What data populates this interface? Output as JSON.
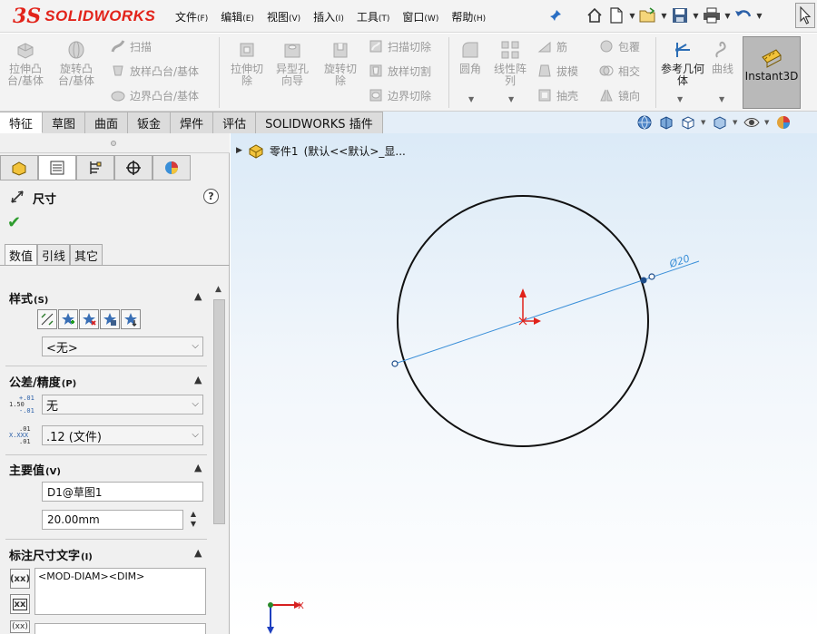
{
  "app": {
    "logo_prefix": "3S",
    "brand": "SOLIDWORKS"
  },
  "menu": [
    {
      "label": "文件",
      "key": "(F)"
    },
    {
      "label": "编辑",
      "key": "(E)"
    },
    {
      "label": "视图",
      "key": "(V)"
    },
    {
      "label": "插入",
      "key": "(I)"
    },
    {
      "label": "工具",
      "key": "(T)"
    },
    {
      "label": "窗口",
      "key": "(W)"
    },
    {
      "label": "帮助",
      "key": "(H)"
    }
  ],
  "ribbon": {
    "extrude_boss": "拉伸凸台/基体",
    "revolve_boss": "旋转凸台/基体",
    "sweep": "扫描",
    "loft_boss": "放样凸台/基体",
    "boundary_boss": "边界凸台/基体",
    "extrude_cut": "拉伸切除",
    "hole_wizard": "异型孔向导",
    "revolve_cut": "旋转切除",
    "swept_cut": "扫描切除",
    "lofted_cut": "放样切割",
    "boundary_cut": "边界切除",
    "fillet": "圆角",
    "linear_pattern": "线性阵列",
    "rib": "筋",
    "draft": "拔模",
    "shell": "抽壳",
    "wrap": "包覆",
    "intersect": "相交",
    "mirror": "镜向",
    "ref_geometry": "参考几何体",
    "curves": "曲线",
    "instant3d": "Instant3D"
  },
  "tabs": [
    "特征",
    "草图",
    "曲面",
    "钣金",
    "焊件",
    "评估",
    "SOLIDWORKS 插件"
  ],
  "tree": {
    "part": "零件1",
    "config": "(默认<<默认>_显..."
  },
  "property_manager": {
    "title": "尺寸",
    "subtabs": [
      "数值",
      "引线",
      "其它"
    ],
    "style": {
      "title": "样式",
      "key": "(S)",
      "value": "<无>"
    },
    "tolerance": {
      "title": "公差/精度",
      "key": "(P)",
      "tol_value": "无",
      "precision_value": ".12 (文件)",
      "tol_icon": [
        "+.01",
        "1.50",
        "-.01"
      ],
      "prec_icon": [
        ".01",
        "X.XXX",
        ".01"
      ]
    },
    "primary": {
      "title": "主要值",
      "key": "(V)",
      "name": "D1@草图1",
      "value": "20.00mm"
    },
    "dimtext": {
      "title": "标注尺寸文字",
      "key": "(I)",
      "text": "<MOD-DIAM><DIM>"
    }
  },
  "sketch": {
    "dimension_label": "Ø20",
    "diameter_mm": 20,
    "axis_x": "X"
  },
  "colors": {
    "accent_red": "#e2231a",
    "dimension_blue": "#3a8fd8",
    "ok_green": "#2e9c2e"
  }
}
